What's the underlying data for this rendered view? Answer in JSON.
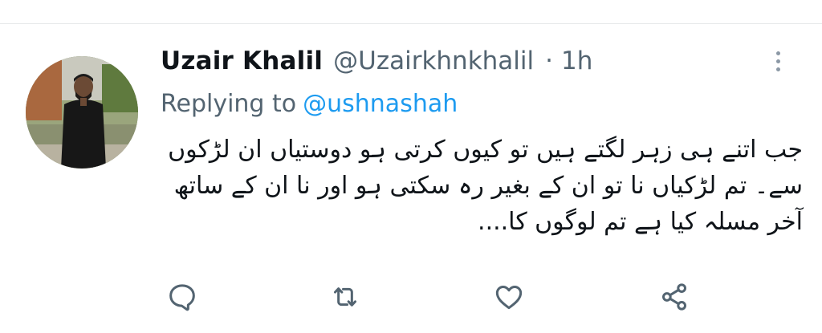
{
  "tweet": {
    "author": {
      "display_name": "Uzair Khalil",
      "handle": "@Uzairkhnkhalil",
      "separator": "·",
      "timestamp": "1h"
    },
    "reply": {
      "prefix": "Replying to",
      "target": "@ushnashah"
    },
    "text": "جب اتنے ہی زہر لگتے ہیں تو کیوں کرتی ہو دوستیاں ان لڑکوں سے۔ تم لڑکیاں نا تو ان کے بغیر رہ سکتی ہو اور نا ان کے ساتھ آخر مسلہ کیا ہے تم لوگوں کا....",
    "actions": {
      "reply_icon": "comment-icon",
      "retweet_icon": "retweet-icon",
      "like_icon": "heart-icon",
      "share_icon": "share-icon"
    },
    "more_icon": "more-vertical-icon"
  },
  "colors": {
    "text_primary": "#0f1419",
    "text_secondary": "#536471",
    "link": "#1d9bf0",
    "icon": "#536471",
    "divider": "#e7e9ea"
  }
}
